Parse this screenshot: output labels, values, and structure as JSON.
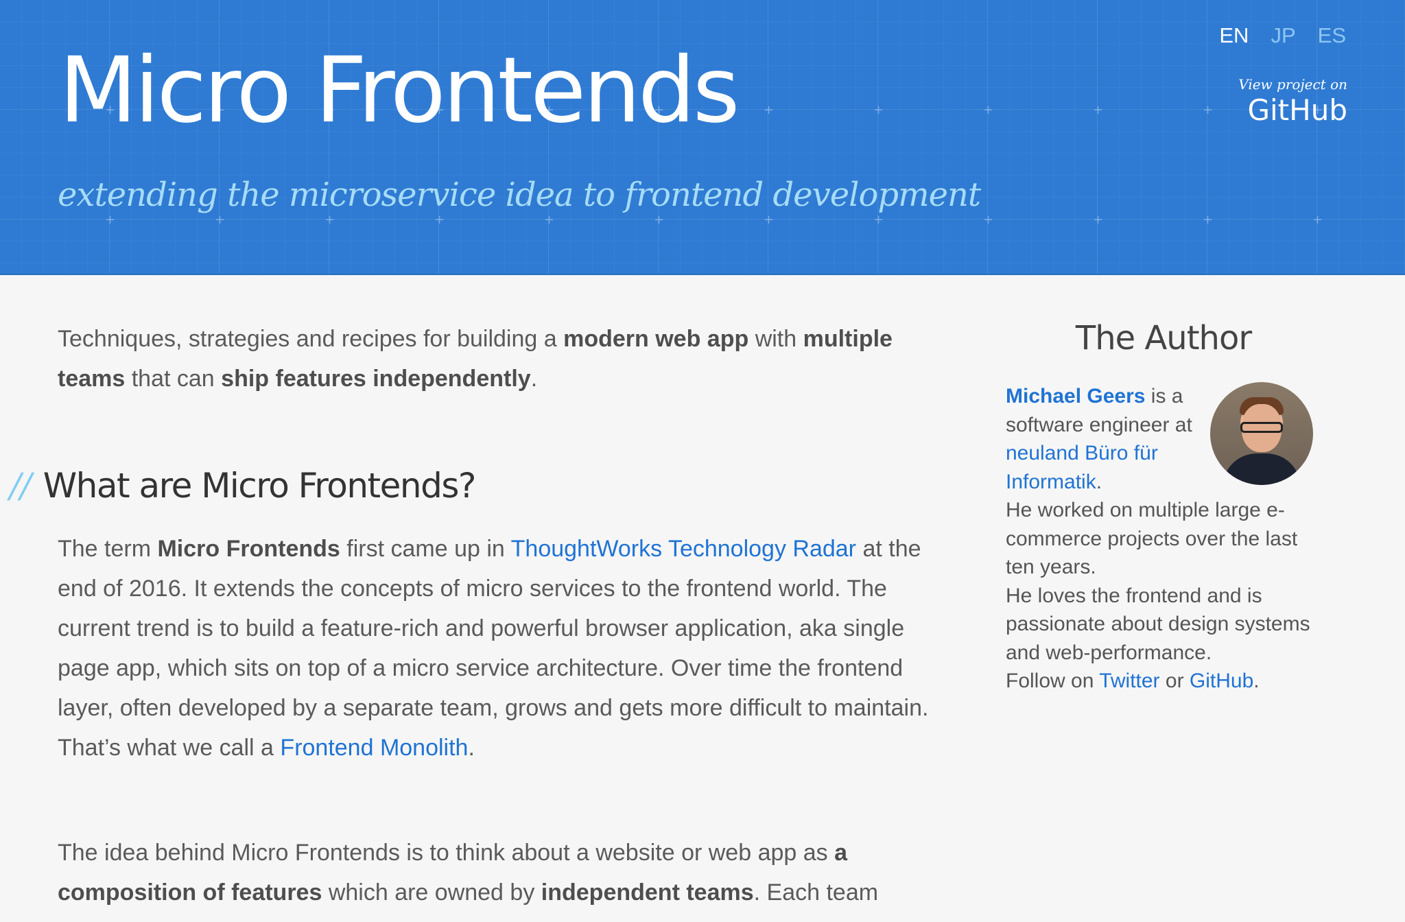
{
  "header": {
    "title": "Micro Frontends",
    "tagline": "extending the microservice idea to frontend development",
    "languages": [
      "EN",
      "JP",
      "ES"
    ],
    "active_language": "EN",
    "github_small": "View project on",
    "github_big": "GitHub"
  },
  "intro": {
    "t1": "Techniques, strategies and recipes for building a ",
    "b1": "modern web app",
    "t2": " with ",
    "b2": "multiple teams",
    "t3": " that can ",
    "b3": "ship features independently",
    "t4": "."
  },
  "section": {
    "slashes": "//",
    "heading": "What are Micro Frontends?"
  },
  "para1": {
    "t1": "The term ",
    "b1": "Micro Frontends",
    "t2": " first came up in ",
    "link1": "ThoughtWorks Technology Radar",
    "t3": " at the end of 2016. It extends the concepts of micro services to the frontend world. The current trend is to build a feature-rich and powerful browser application, aka single page app, which sits on top of a micro service architecture. Over time the frontend layer, often developed by a separate team, grows and gets more difficult to maintain. That’s what we call a ",
    "link2": "Frontend Monolith",
    "t4": "."
  },
  "para2": {
    "t1": "The idea behind Micro Frontends is to think about a website or web app as ",
    "b1": "a composition of features",
    "t2": " which are owned by ",
    "b2": "independent teams",
    "t3": ". Each team"
  },
  "sidebar": {
    "title": "The Author",
    "author_name": "Michael Geers",
    "bio_1": " is a software engineer at ",
    "company": "neuland Büro für Informatik",
    "bio_2": ".",
    "bio_3": "He worked on multiple large e-commerce projects over the last ten years.",
    "bio_4": "He loves the frontend and is passionate about design systems and web-performance.",
    "follow_prefix": "Follow on ",
    "twitter": "Twitter",
    "or": " or ",
    "github": "GitHub",
    "follow_suffix": "."
  },
  "colors": {
    "header_bg": "#2f7bd3",
    "tagline": "#a7dcf7",
    "link": "#1f73d4",
    "accent_slashes": "#80cdf3"
  }
}
